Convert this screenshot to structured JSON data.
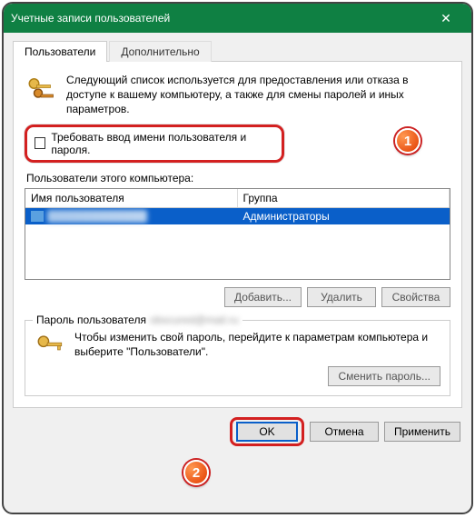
{
  "window": {
    "title": "Учетные записи пользователей",
    "close": "✕"
  },
  "tabs": {
    "users": "Пользователи",
    "advanced": "Дополнительно"
  },
  "intro": "Следующий список используется для предоставления или отказа в доступе к вашему компьютеру, а также для смены паролей и иных параметров.",
  "require_login": "Требовать ввод имени пользователя и пароля.",
  "list_label": "Пользователи этого компьютера:",
  "table": {
    "col_user": "Имя пользователя",
    "col_group": "Группа",
    "row_user": "obscured@mail.ru",
    "row_group": "Администраторы"
  },
  "buttons": {
    "add": "Добавить...",
    "remove": "Удалить",
    "props": "Свойства"
  },
  "pw_group": {
    "legend_prefix": "Пароль пользователя",
    "legend_user": "obscured@mail.ru",
    "text": "Чтобы изменить свой пароль, перейдите к параметрам компьютера и выберите \"Пользователи\".",
    "change": "Сменить пароль..."
  },
  "footer": {
    "ok": "OK",
    "cancel": "Отмена",
    "apply": "Применить"
  },
  "badges": {
    "one": "1",
    "two": "2"
  }
}
